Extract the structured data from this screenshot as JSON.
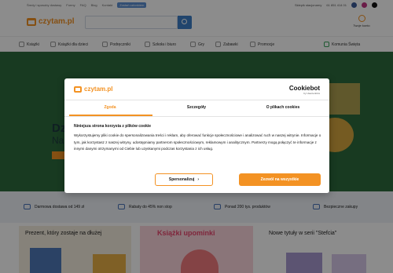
{
  "topbar": {
    "links": [
      "Średy i sposoby dostawy",
      "Formy",
      "FAQ",
      "Blog",
      "Kontakt"
    ],
    "badge": "Zostań członkiem",
    "status": "Sklepik stacjonarny",
    "phone": "61 851 414 01"
  },
  "header": {
    "logo_text": "czytam.pl",
    "search_placeholder": "",
    "account_label": "Twoje konto"
  },
  "nav": {
    "items": [
      {
        "label": "Książki",
        "icon": "book-icon"
      },
      {
        "label": "Książki dla dzieci",
        "icon": "child-icon"
      },
      {
        "label": "Podręczniki",
        "icon": "textbook-icon"
      },
      {
        "label": "Szkoła i biuro",
        "icon": "school-icon"
      },
      {
        "label": "Gry",
        "icon": "game-icon"
      },
      {
        "label": "Zabawki",
        "icon": "toy-icon"
      },
      {
        "label": "Promocje",
        "icon": "percent-icon"
      },
      {
        "label": "Komunia Święta",
        "icon": "cross-icon"
      }
    ]
  },
  "hero": {
    "heading_fragment": "Dz",
    "subheading_fragment": "Na"
  },
  "benefits": [
    {
      "label": "Darmowa dostawa od 149 zł",
      "icon": "truck-icon"
    },
    {
      "label": "Rabaty do 45% non stop",
      "icon": "tag-icon"
    },
    {
      "label": "Ponad 200 tys. produktów",
      "icon": "box-icon"
    },
    {
      "label": "Bezpieczne zakupy",
      "icon": "shield-icon"
    }
  ],
  "products": {
    "col1_title": "Prezent, który zostaje na dłużej",
    "col2_title": "Książki upominki",
    "col3_title": "Nowe tytuły w serii \"Stefcia\""
  },
  "cookie_dialog": {
    "logo_text": "czytam.pl",
    "cookiebot_title": "Cookiebot",
    "cookiebot_sub": "by Usercentrics",
    "tabs": [
      {
        "label": "Zgoda",
        "active": true
      },
      {
        "label": "Szczegóły",
        "active": false
      },
      {
        "label": "O plikach cookies",
        "active": false
      }
    ],
    "title": "Niniejsza strona korzysta z plików cookie",
    "body": "Wykorzystujemy pliki cookie do spersonalizowania treści i reklam, aby oferować funkcje społecznościowe i analizować ruch w naszej witrynie. Informacje o tym, jak korzystasz z naszej witryny, udostępniamy partnerom społecznościowym, reklamowym i analitycznym. Partnerzy mogą połączyć te informacje z innymi danymi otrzymanymi od Ciebie lub uzyskanymi podczas korzystania z ich usług.",
    "settings_button": "Spersonalizuj",
    "accept_button": "Zezwól na wszystkie"
  },
  "colors": {
    "accent": "#f39223",
    "overlay": "rgba(0,0,0,0.45)",
    "search_button": "#3c7fc7"
  }
}
